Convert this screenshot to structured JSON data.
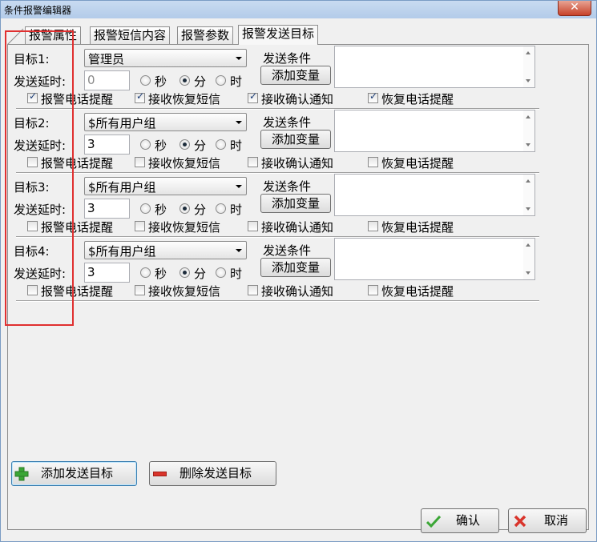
{
  "window": {
    "title": "条件报警编辑器",
    "close_label": "✕"
  },
  "tabs": [
    {
      "label": "报警属性",
      "active": false
    },
    {
      "label": "报警短信内容",
      "active": false
    },
    {
      "label": "报警参数",
      "active": false
    },
    {
      "label": "报警发送目标",
      "active": true
    }
  ],
  "common": {
    "delay_label": "发送延时:",
    "unit_seconds": "秒",
    "unit_minutes": "分",
    "unit_hours": "时",
    "send_condition_label": "发送条件",
    "add_variable_button": "添加变量",
    "opt_alarm_phone": "报警电话提醒",
    "opt_recv_recovery_sms": "接收恢复短信",
    "opt_recv_confirm": "接收确认通知",
    "opt_recovery_phone": "恢复电话提醒"
  },
  "targets": [
    {
      "label": "目标1:",
      "recipient": "管理员",
      "delay": "0",
      "unit": "minutes",
      "alarm_phone": true,
      "recv_recovery_sms": true,
      "recv_confirm": true,
      "recovery_phone": true
    },
    {
      "label": "目标2:",
      "recipient": "$所有用户组",
      "delay": "3",
      "unit": "minutes",
      "alarm_phone": false,
      "recv_recovery_sms": false,
      "recv_confirm": false,
      "recovery_phone": false
    },
    {
      "label": "目标3:",
      "recipient": "$所有用户组",
      "delay": "3",
      "unit": "minutes",
      "alarm_phone": false,
      "recv_recovery_sms": false,
      "recv_confirm": false,
      "recovery_phone": false
    },
    {
      "label": "目标4:",
      "recipient": "$所有用户组",
      "delay": "3",
      "unit": "minutes",
      "alarm_phone": false,
      "recv_recovery_sms": false,
      "recv_confirm": false,
      "recovery_phone": false
    }
  ],
  "buttons": {
    "add_target": "添加发送目标",
    "delete_target": "删除发送目标",
    "ok": "确认",
    "cancel": "取消"
  },
  "colors": {
    "highlight_box": "#e03030",
    "add_icon": "#3aa635",
    "delete_icon": "#d9342b",
    "ok_icon": "#3aa635",
    "cancel_icon": "#d9342b"
  },
  "icons": {
    "add_target": "plus-icon",
    "delete_target": "minus-icon",
    "ok": "check-icon",
    "cancel": "x-icon"
  }
}
